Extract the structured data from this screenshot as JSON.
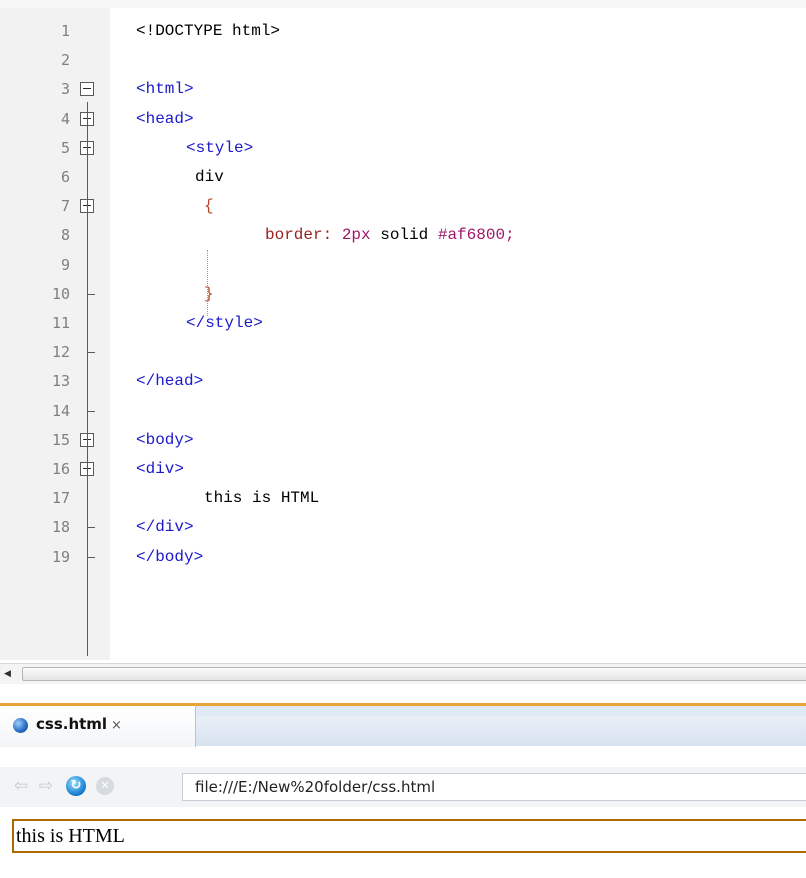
{
  "editor": {
    "lines": [
      {
        "n": "1",
        "segments": [
          {
            "cls": "c-plain",
            "t": "<!DOCTYPE html>"
          }
        ]
      },
      {
        "n": "2",
        "segments": []
      },
      {
        "n": "3",
        "segments": [
          {
            "cls": "c-tag",
            "t": "<html>"
          }
        ]
      },
      {
        "n": "4",
        "segments": [
          {
            "cls": "c-tag",
            "t": "<head>"
          }
        ]
      },
      {
        "n": "5",
        "segments": [
          {
            "cls": "c-tag",
            "t": "<style>"
          }
        ]
      },
      {
        "n": "6",
        "segments": [
          {
            "cls": "c-plain",
            "t": "div"
          }
        ]
      },
      {
        "n": "7",
        "segments": [
          {
            "cls": "c-brace",
            "t": "{"
          }
        ]
      },
      {
        "n": "8",
        "segments": [
          {
            "cls": "c-prop",
            "t": "border: "
          },
          {
            "cls": "c-num",
            "t": "2px"
          },
          {
            "cls": "c-plain",
            "t": " solid "
          },
          {
            "cls": "c-hex",
            "t": "#af6800;"
          }
        ]
      },
      {
        "n": "9",
        "segments": []
      },
      {
        "n": "10",
        "segments": [
          {
            "cls": "c-brace",
            "t": "}"
          }
        ]
      },
      {
        "n": "11",
        "segments": [
          {
            "cls": "c-tag",
            "t": "</style>"
          }
        ]
      },
      {
        "n": "12",
        "segments": []
      },
      {
        "n": "13",
        "segments": [
          {
            "cls": "c-tag",
            "t": "</head>"
          }
        ]
      },
      {
        "n": "14",
        "segments": []
      },
      {
        "n": "15",
        "segments": [
          {
            "cls": "c-tag",
            "t": "<body>"
          }
        ]
      },
      {
        "n": "16",
        "segments": [
          {
            "cls": "c-tag",
            "t": "<div>"
          }
        ]
      },
      {
        "n": "17",
        "segments": [
          {
            "cls": "c-plain",
            "t": "this is HTML"
          }
        ]
      },
      {
        "n": "18",
        "segments": [
          {
            "cls": "c-tag",
            "t": "</div>"
          }
        ]
      },
      {
        "n": "19",
        "segments": [
          {
            "cls": "c-tag",
            "t": "</body>"
          }
        ]
      }
    ]
  },
  "browser": {
    "tab_title": "css.html",
    "tab_close": "×",
    "url": "file:///E:/New%20folder/css.html",
    "nav": {
      "back": "⇦",
      "forward": "⇨",
      "refresh": "↻",
      "stop": "✕"
    },
    "page_text": "this is HTML",
    "div_border_color": "#af6800"
  },
  "scrollbar": {
    "left_arrow": "◀"
  }
}
